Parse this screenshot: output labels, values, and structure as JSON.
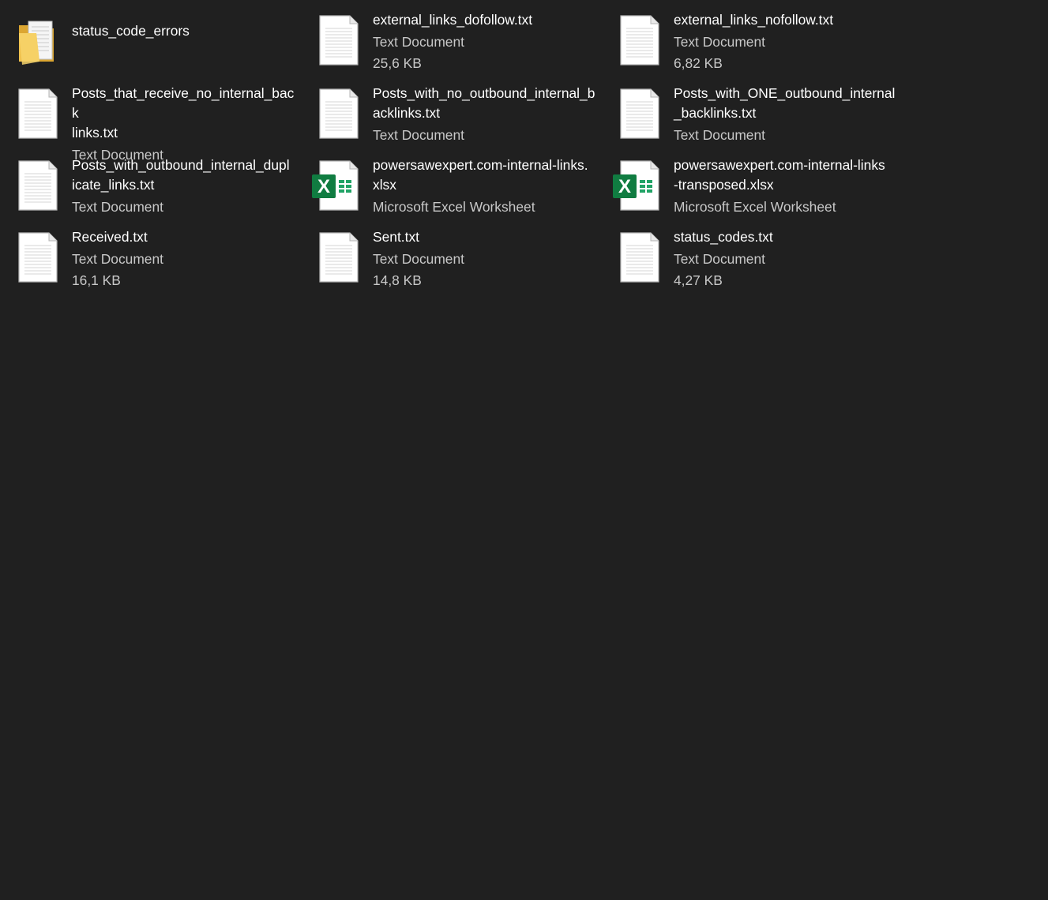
{
  "items": [
    {
      "icon": "folder-icon",
      "name": "status_code_errors",
      "type": "",
      "size": ""
    },
    {
      "icon": "text-document-icon",
      "name": "external_links_dofollow.txt",
      "type": "Text Document",
      "size": "25,6 KB"
    },
    {
      "icon": "text-document-icon",
      "name": "external_links_nofollow.txt",
      "type": "Text Document",
      "size": "6,82 KB"
    },
    {
      "icon": "text-document-icon",
      "name": "Posts_that_receive_no_internal_back\nlinks.txt",
      "type": "Text Document",
      "size": ""
    },
    {
      "icon": "text-document-icon",
      "name": "Posts_with_no_outbound_internal_b\nacklinks.txt",
      "type": "Text Document",
      "size": ""
    },
    {
      "icon": "text-document-icon",
      "name": "Posts_with_ONE_outbound_internal\n_backlinks.txt",
      "type": "Text Document",
      "size": ""
    },
    {
      "icon": "text-document-icon",
      "name": "Posts_with_outbound_internal_dupl\nicate_links.txt",
      "type": "Text Document",
      "size": ""
    },
    {
      "icon": "excel-file-icon",
      "name": "powersawexpert.com-internal-links.\nxlsx",
      "type": "Microsoft Excel Worksheet",
      "size": ""
    },
    {
      "icon": "excel-file-icon",
      "name": "powersawexpert.com-internal-links\n-transposed.xlsx",
      "type": "Microsoft Excel Worksheet",
      "size": ""
    },
    {
      "icon": "text-document-icon",
      "name": "Received.txt",
      "type": "Text Document",
      "size": "16,1 KB"
    },
    {
      "icon": "text-document-icon",
      "name": "Sent.txt",
      "type": "Text Document",
      "size": "14,8 KB"
    },
    {
      "icon": "text-document-icon",
      "name": "status_codes.txt",
      "type": "Text Document",
      "size": "4,27 KB"
    }
  ],
  "colors": {
    "background": "#202020",
    "primary_text": "#ffffff",
    "secondary_text": "#c8c8c8",
    "excel_green": "#107c41",
    "folder_yellow": "#f0c24d"
  }
}
